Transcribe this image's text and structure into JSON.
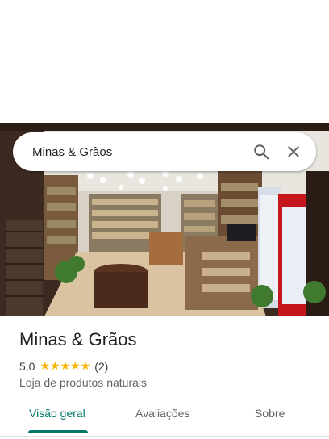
{
  "search": {
    "query": "Minas & Grãos"
  },
  "place": {
    "name": "Minas & Grãos",
    "rating": "5,0",
    "stars": "★★★★★",
    "review_count": "(2)",
    "category": "Loja de produtos naturais"
  },
  "tabs": [
    {
      "label": "Visão geral",
      "active": true
    },
    {
      "label": "Avaliações"
    },
    {
      "label": "Sobre"
    }
  ],
  "colors": {
    "accent": "#00796b",
    "star": "#f5b400"
  },
  "icons": {
    "search": "search-icon",
    "close": "close-icon"
  }
}
